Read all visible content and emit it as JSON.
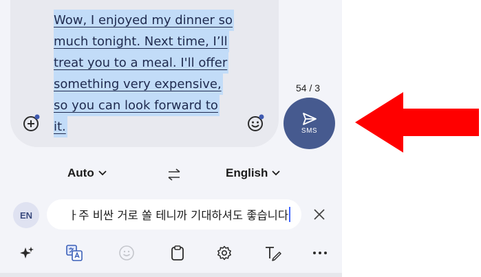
{
  "compose": {
    "message_lines": [
      "Wow, I enjoyed my dinner so",
      "much tonight. Next time, I’ll",
      "treat you to a meal. I'll offer",
      "something very expensive,",
      "so you can look forward to",
      "it."
    ],
    "counter": "54 / 3",
    "send_label": "SMS",
    "icons": {
      "add": "plus-circle-icon",
      "emoji": "emoji-icon",
      "send": "send-icon"
    }
  },
  "translate": {
    "source_lang": "Auto",
    "target_lang": "English",
    "badge": "EN",
    "text": "ㅏ주 비싼 거로 쏠 테니까 기대하셔도 좋습니다"
  },
  "toolbar": [
    "sparkle-icon",
    "translate-icon",
    "emoji-icon",
    "clipboard-icon",
    "settings-icon",
    "handwriting-icon",
    "more-icon"
  ],
  "colors": {
    "accent": "#465a8f",
    "highlight": "#c2dcf8",
    "arrow": "#ff0000"
  }
}
